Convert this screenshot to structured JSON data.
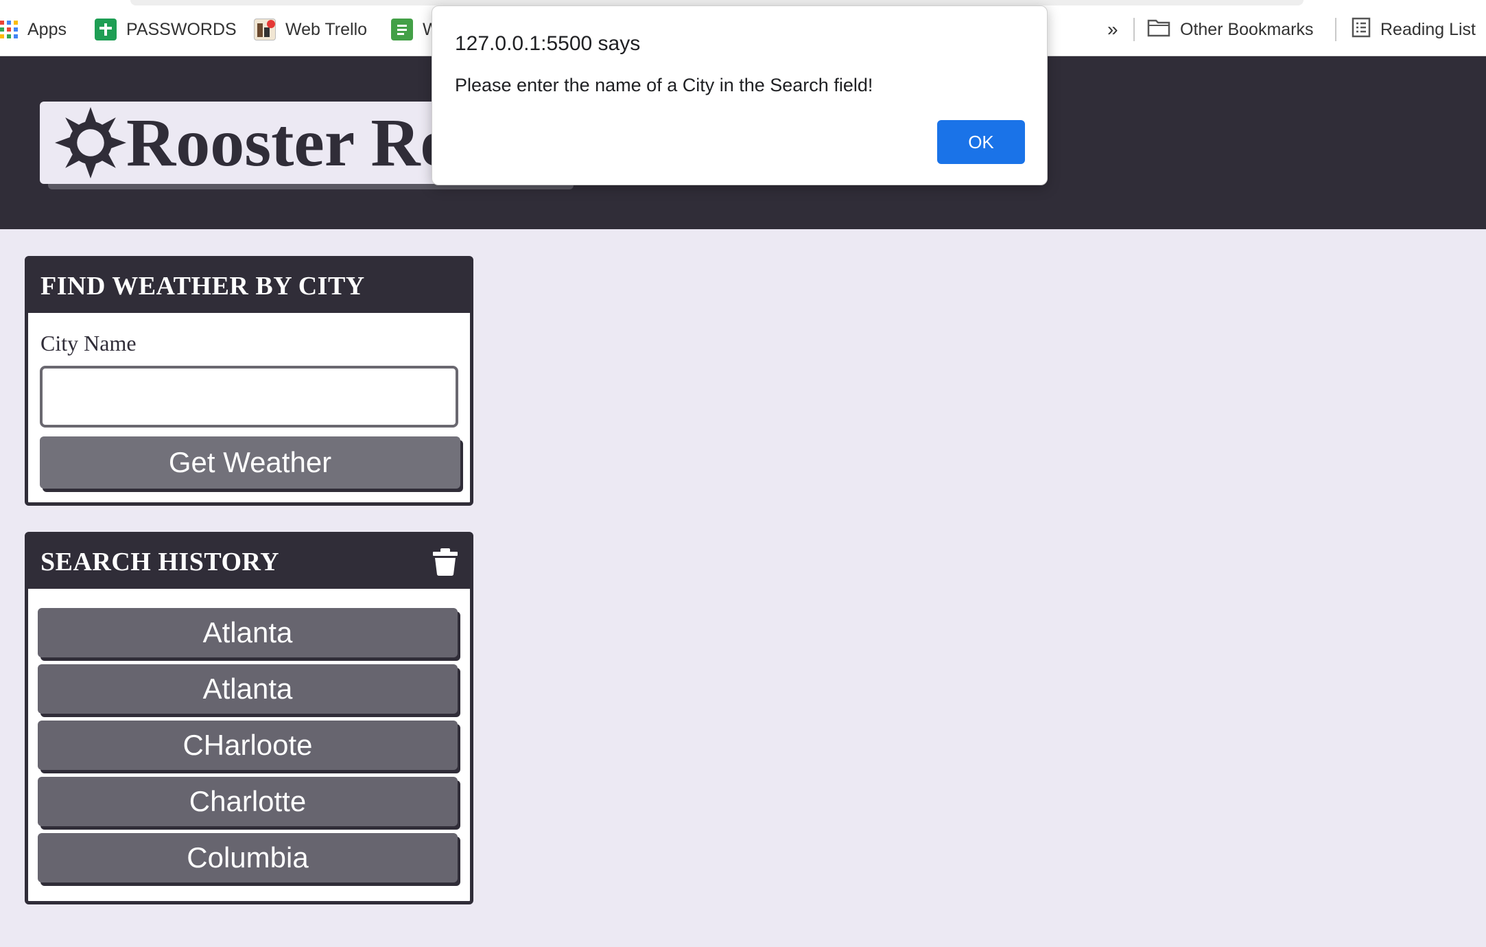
{
  "bookmarks": {
    "apps_label": "Apps",
    "passwords_label": "PASSWORDS",
    "trello_label": "Web Trello",
    "truncated_label": "W",
    "overflow_label": "»",
    "other_label": "Other Bookmarks",
    "reading_label": "Reading List"
  },
  "header": {
    "logo_text": "Rooster Re"
  },
  "search": {
    "title": "FIND WEATHER BY CITY",
    "city_label": "City Name",
    "input_value": "",
    "button_label": "Get Weather"
  },
  "history": {
    "title": "SEARCH HISTORY",
    "items": [
      "Atlanta",
      "Atlanta",
      "CHarloote",
      "Charlotte",
      "Columbia"
    ]
  },
  "alert": {
    "origin": "127.0.0.1:5500 says",
    "message": "Please enter the name of a City in the Search field!",
    "ok_label": "OK"
  },
  "colors": {
    "header_bg": "#302d38",
    "page_bg": "#ece9f3",
    "button_gray": "#72717a",
    "history_button": "#67656f",
    "alert_ok": "#1a73e8"
  },
  "icons": {
    "apps": "apps-grid-icon",
    "passwords": "google-sheets-icon",
    "trello": "trello-icon",
    "docs": "google-docs-icon",
    "folder": "folder-icon",
    "reading": "reading-list-icon",
    "logo": "sun-icon",
    "trash": "trash-icon"
  }
}
